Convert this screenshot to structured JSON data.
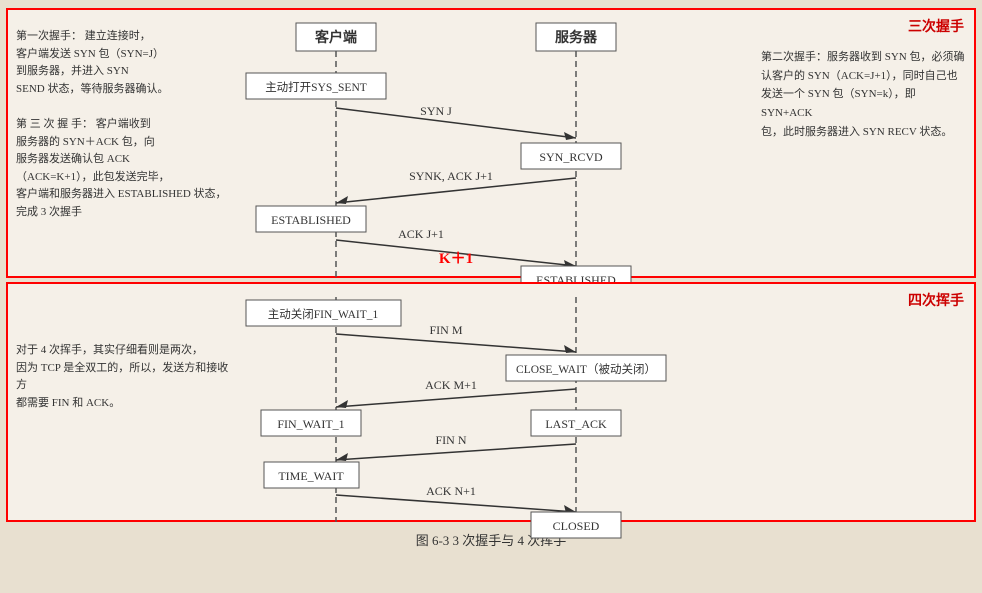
{
  "top_panel": {
    "label": "三次握手",
    "left_text": [
      "第一次握手：  建立连接时，",
      "客户端发送 SYN 包（SYN=J）",
      "到服务器，并进入 SYN",
      "SEND 状态，等待服务器确认。",
      "",
      "第 三 次 握 手：  客户端收到",
      "服务器的 SYN＋ACK 包，向",
      "服务器发送确认包 ACK",
      "（ACK=K+1），此包发送完毕，",
      "客户端和服务器进入 ESTABLISHED 状态，",
      "完成 3 次握手"
    ],
    "right_text": [
      "第二次握手：服务器收到 SYN 包，必须确",
      "认客户的 SYN（ACK=J+1），同时自己也",
      "发送一个 SYN 包（SYN=k），即 SYN+ACK",
      "包，此时服务器进入 SYN RECV 状态。"
    ],
    "client_label": "客户端",
    "server_label": "服务器",
    "states": {
      "sys_sent": "主动打开SYS_SENT",
      "established_client": "ESTABLISHED",
      "syn_rcvd": "SYN_RCVD",
      "established_server": "ESTABLISHED"
    },
    "arrows": [
      {
        "label": "SYN J",
        "direction": "right"
      },
      {
        "label": "SYNK, ACK J+1",
        "direction": "left"
      },
      {
        "label": "ACK J+1",
        "direction": "right"
      },
      {
        "label": "K+1",
        "direction": "right",
        "red": true
      }
    ]
  },
  "bottom_panel": {
    "label": "四次挥手",
    "left_text": [
      "对于 4 次挥手，其实仔细看则是两次，",
      "因为 TCP 是全双工的，所以，发送方和接收方",
      "都需要 FIN 和 ACK。"
    ],
    "states": {
      "fin_wait_1": "主动关闭FIN_WAIT_1",
      "fin_wait_2": "FIN_WAIT_1",
      "time_wait": "TIME_WAIT",
      "close_wait": "CLOSE_WAIT（被动关闭）",
      "last_ack": "LAST_ACK",
      "closed": "CLOSED"
    },
    "arrows": [
      {
        "label": "FIN M",
        "direction": "right"
      },
      {
        "label": "ACK M+1",
        "direction": "left"
      },
      {
        "label": "FIN N",
        "direction": "left"
      },
      {
        "label": "ACK N+1",
        "direction": "right"
      }
    ]
  },
  "caption": "图 6-3   3 次握手与 4 次挥手"
}
